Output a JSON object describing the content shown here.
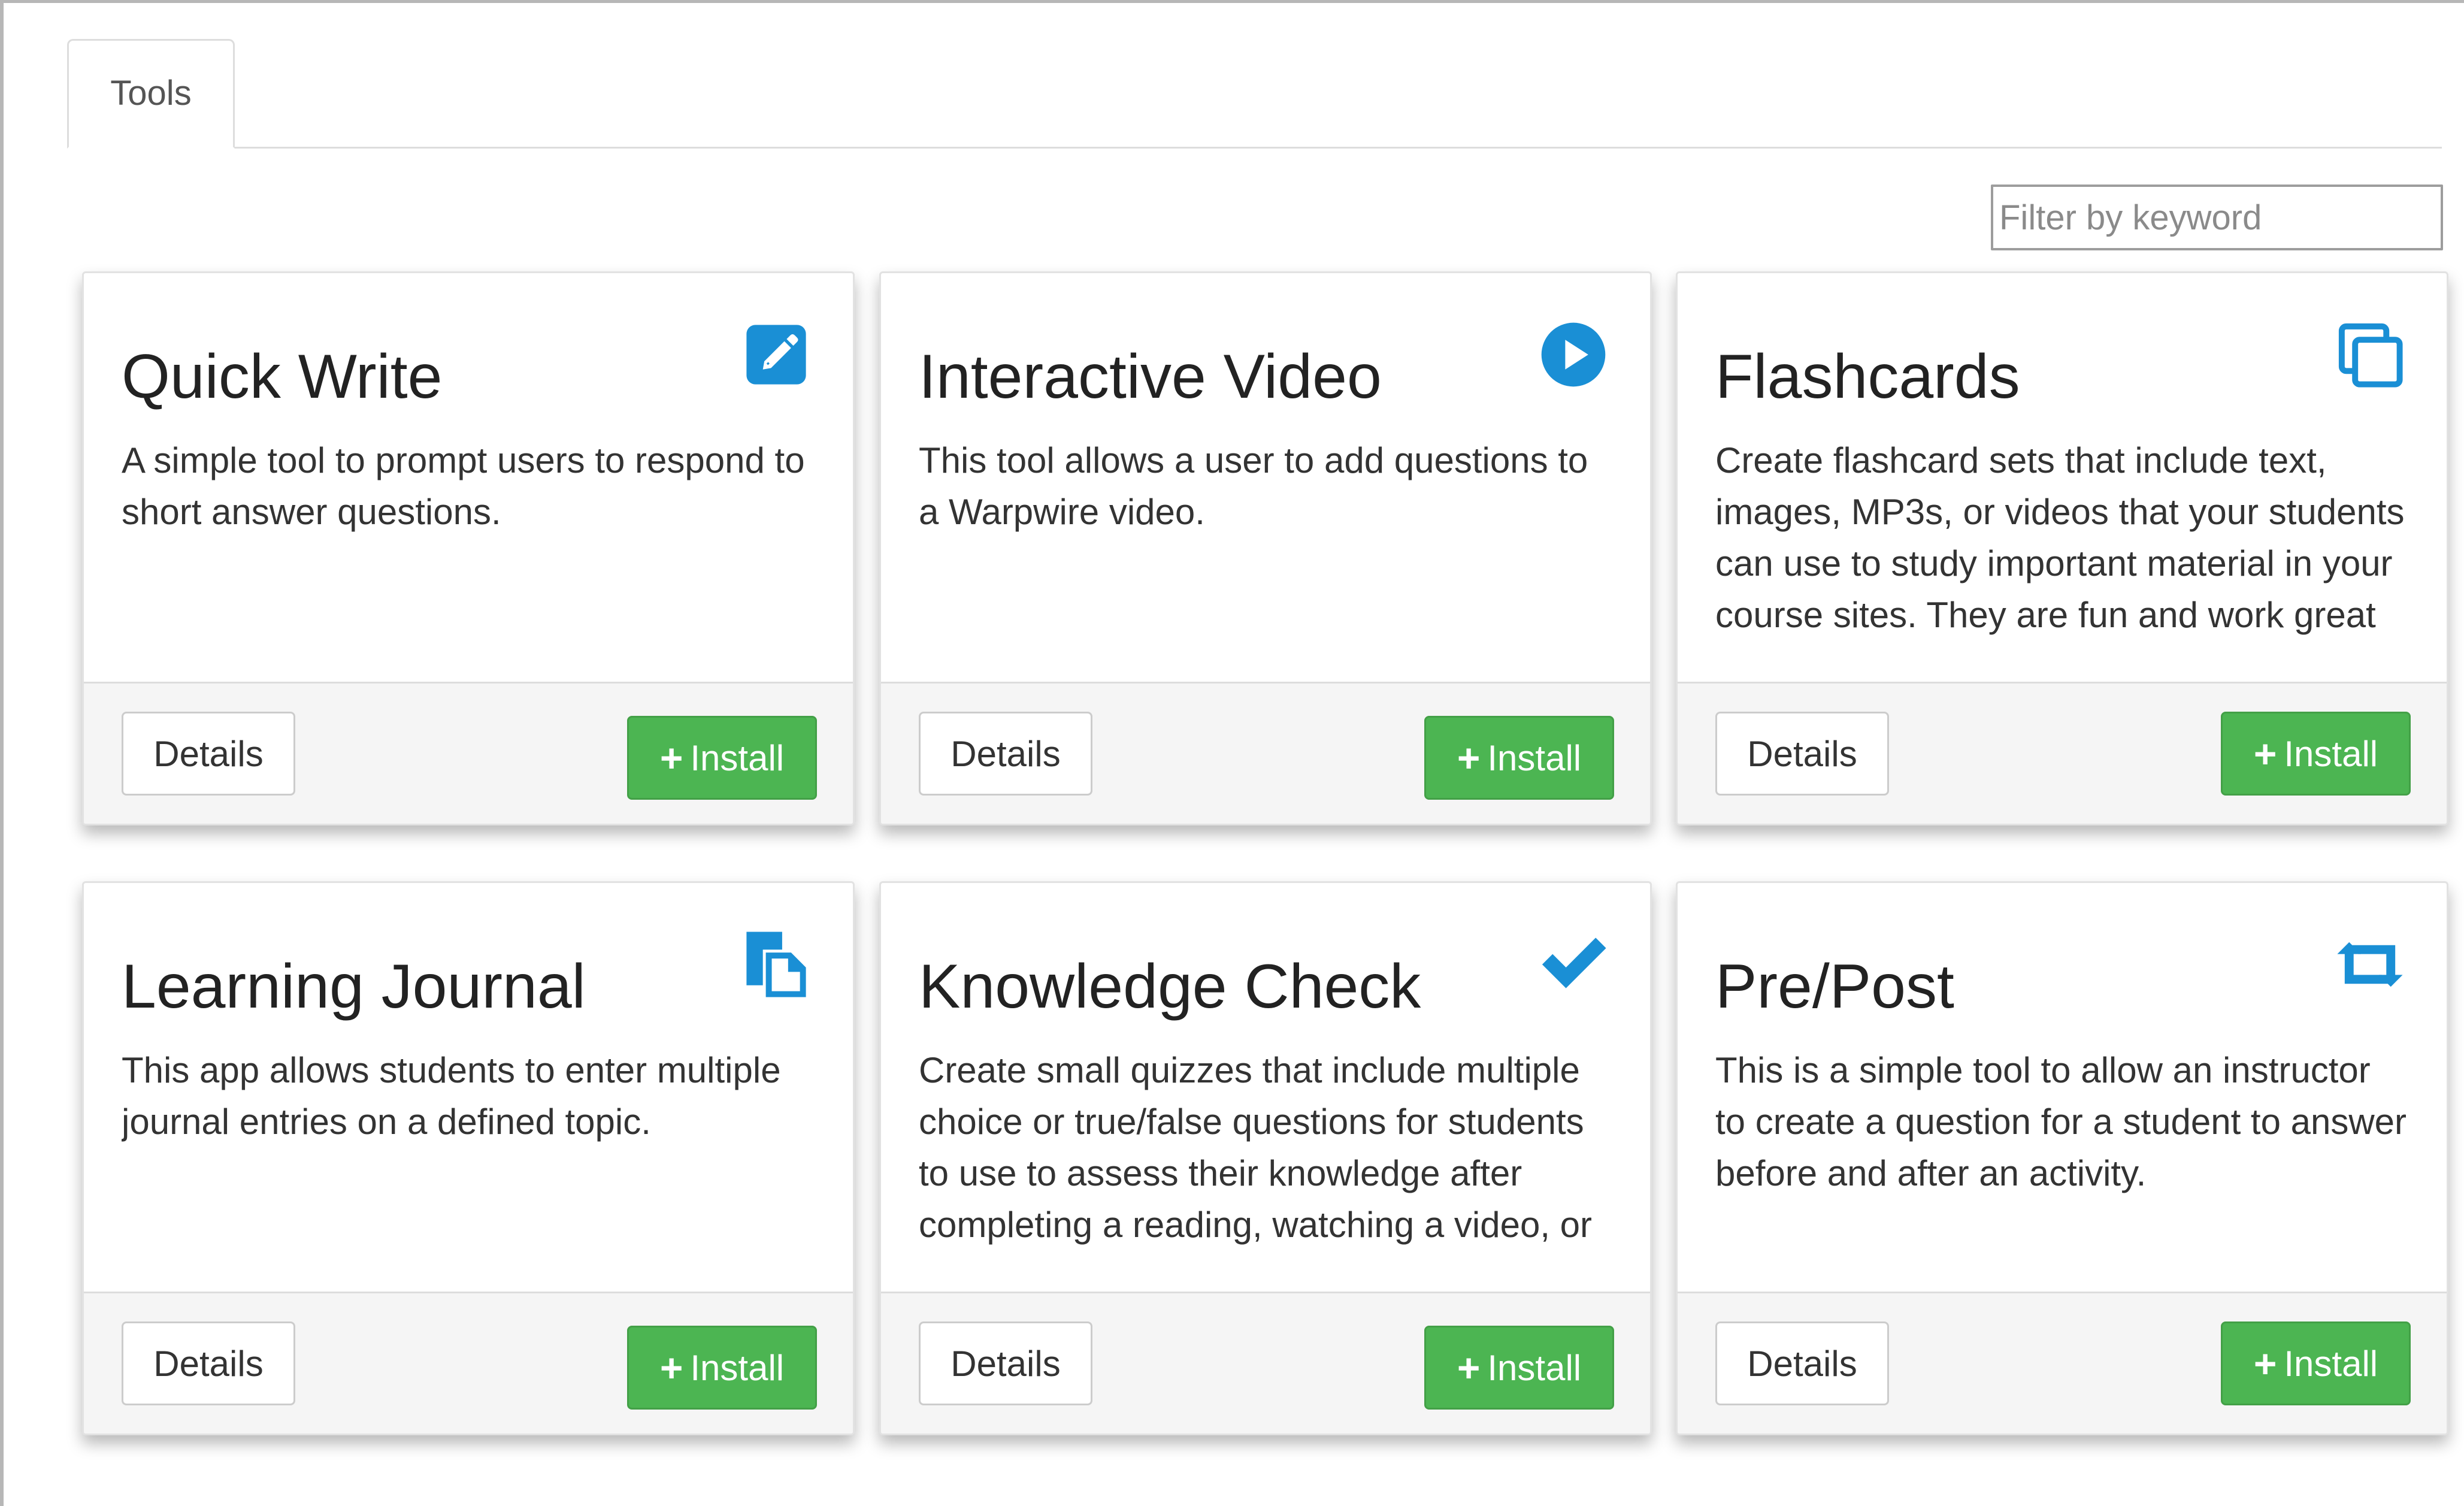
{
  "tabs": [
    {
      "label": "Tools"
    }
  ],
  "filter": {
    "placeholder": "Filter by keyword",
    "value": ""
  },
  "accent_color": "#1a8fd5",
  "install_color": "#4cb552",
  "cards": [
    {
      "title": "Quick Write",
      "icon": "pencil-square-icon",
      "description": "A simple tool to prompt users to respond to short answer questions.",
      "details_label": "Details",
      "install_label": "Install"
    },
    {
      "title": "Interactive Video",
      "icon": "play-circle-icon",
      "description": "This tool allows a user to add questions to a Warpwire video.",
      "details_label": "Details",
      "install_label": "Install"
    },
    {
      "title": "Flashcards",
      "icon": "copy-cards-icon",
      "description": "Create flashcard sets that include text, images, MP3s, or videos that your students can use to study important material in your course sites. They are fun and work great",
      "details_label": "Details",
      "install_label": "Install"
    },
    {
      "title": "Learning Journal",
      "icon": "files-icon",
      "description": "This app allows students to enter multiple journal entries on a defined topic.",
      "details_label": "Details",
      "install_label": "Install"
    },
    {
      "title": "Knowledge Check",
      "icon": "checkmark-icon",
      "description": "Create small quizzes that include multiple choice or true/false questions for students to use to assess their knowledge after completing a reading, watching a video, or",
      "details_label": "Details",
      "install_label": "Install"
    },
    {
      "title": "Pre/Post",
      "icon": "retweet-icon",
      "description": "This is a simple tool to allow an instructor to create a question for a student to answer before and after an activity.",
      "details_label": "Details",
      "install_label": "Install"
    }
  ]
}
